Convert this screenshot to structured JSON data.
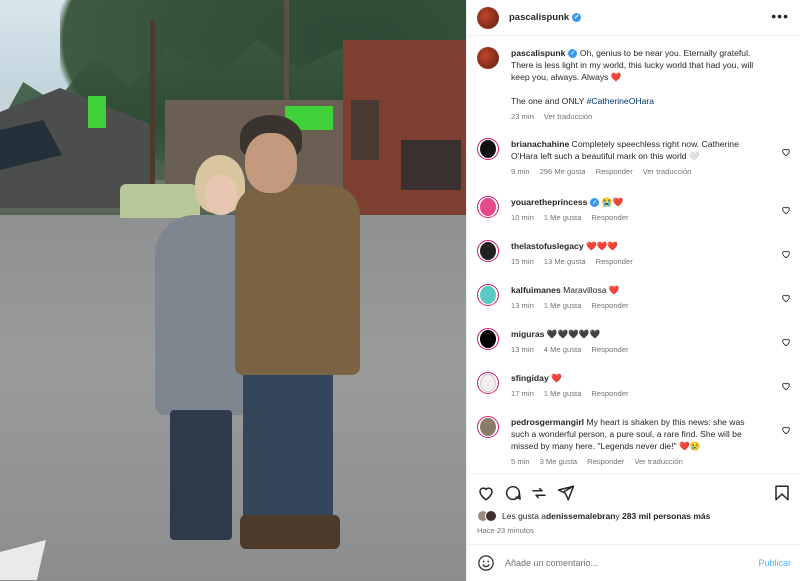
{
  "post": {
    "author": "pascalispunk",
    "verified": true
  },
  "caption": {
    "username": "pascalispunk",
    "text": "Oh, genius to be near you. Eternally grateful. There is less light in my world, this lucky world that had you, will keep you, always. Always ❤️",
    "text2_prefix": "The one and ONLY ",
    "hashtag": "#CatherineOHara",
    "time": "23 min",
    "translate": "Ver traducción"
  },
  "comments": [
    {
      "user": "brianachahine",
      "text": "Completely speechless right now. Catherine O'Hara left such a beautiful mark on this world 🤍",
      "time": "9 min",
      "likes": "296 Me gusta",
      "reply": "Responder",
      "translate": "Ver traducción"
    },
    {
      "user": "youaretheprincess",
      "verified": true,
      "text": "😭❤️",
      "time": "10 min",
      "likes": "1 Me gusta",
      "reply": "Responder"
    },
    {
      "user": "thelastofuslegacy",
      "text": "❤️❤️❤️",
      "time": "15 min",
      "likes": "13 Me gusta",
      "reply": "Responder"
    },
    {
      "user": "kalfuimanes",
      "text": "Maravillosa ❤️",
      "time": "13 min",
      "likes": "1 Me gusta",
      "reply": "Responder"
    },
    {
      "user": "miguras",
      "text": "🖤🖤🖤🖤🖤",
      "time": "13 min",
      "likes": "4 Me gusta",
      "reply": "Responder"
    },
    {
      "user": "sfingiday",
      "text": "❤️",
      "time": "17 min",
      "likes": "1 Me gusta",
      "reply": "Responder"
    },
    {
      "user": "pedrosgermangirl",
      "text": "My heart is shaken by this news: she was such a wonderful person, a pure soul, a rare find. She will be missed by many here. \"Legends never die!\" ❤️😢",
      "time": "5 min",
      "likes": "3 Me gusta",
      "reply": "Responder",
      "translate": "Ver traducción"
    }
  ],
  "likes": {
    "prefix": "Les gusta a ",
    "user": "denissemalebran",
    "suffix": " y ",
    "count": "283 mil personas más"
  },
  "posted": "Hace 23 minutos",
  "composer": {
    "placeholder": "Añade un comentario...",
    "publish": "Publicar"
  },
  "icons": [
    "more-icon",
    "heart-icon",
    "comment-icon",
    "share-icon",
    "send-icon",
    "bookmark-icon",
    "emoji-icon",
    "verified-icon"
  ],
  "colors": {
    "accent": "#4cb5f9",
    "verified": "#3897f0",
    "link": "#00376b",
    "heart": "#ed4956"
  }
}
